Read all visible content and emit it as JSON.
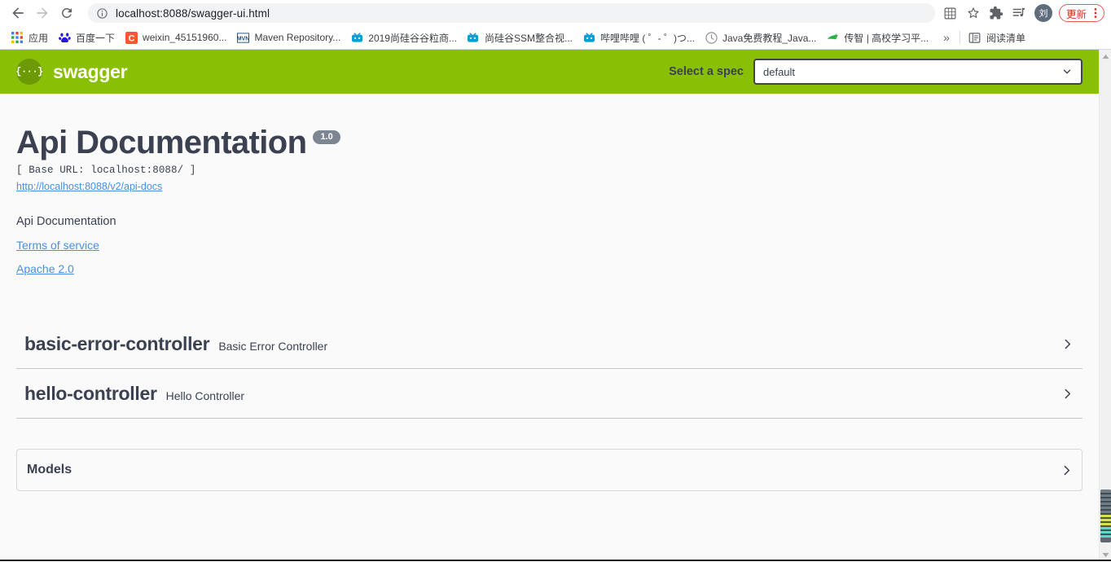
{
  "browser": {
    "nav": {
      "back_icon": "arrow-left-icon",
      "forward_icon": "arrow-right-icon",
      "reload_icon": "reload-icon"
    },
    "omnibox": {
      "info_icon": "info-circle-icon",
      "url": "localhost:8088/swagger-ui.html",
      "url_host": "localhost:8088",
      "url_path": "/swagger-ui.html"
    },
    "toolbar_right": {
      "grid_icon": "grid-panel-icon",
      "bookmark_icon": "star-icon",
      "extensions_icon": "puzzle-piece-icon",
      "reading_list_icon": "playlist-icon",
      "avatar_label": "刘",
      "update_label": "更新",
      "menu_icon": "kebab-menu-icon"
    },
    "bookmarks": [
      {
        "label": "应用",
        "icon": "apps-grid-icon"
      },
      {
        "label": "百度一下",
        "icon": "baidu-icon"
      },
      {
        "label": "weixin_45151960...",
        "icon": "csdn-icon"
      },
      {
        "label": "Maven Repository...",
        "icon": "maven-icon"
      },
      {
        "label": "2019尚硅谷谷粒商...",
        "icon": "bilibili-icon"
      },
      {
        "label": "尚硅谷SSM整合视...",
        "icon": "bilibili-icon"
      },
      {
        "label": "哔哩哔哩 ( ゜- ゜)つ...",
        "icon": "bilibili-icon"
      },
      {
        "label": "Java免费教程_Java...",
        "icon": "clock-icon"
      },
      {
        "label": "传智 | 高校学习平...",
        "icon": "itcast-icon"
      }
    ],
    "bookmarks_overflow": "»",
    "reading_list": {
      "label": "阅读清单",
      "icon": "reading-list-icon"
    }
  },
  "swagger": {
    "topbar": {
      "logo_mark": "{···}",
      "wordmark": "swagger",
      "spec_label": "Select a spec",
      "spec_selected": "default",
      "spec_options": [
        "default"
      ],
      "chevron_icon": "chevron-down-icon"
    },
    "info": {
      "title": "Api Documentation",
      "version": "1.0",
      "base_url": "[ Base URL: localhost:8088/ ]",
      "api_docs_link": "http://localhost:8088/v2/api-docs",
      "description": "Api Documentation",
      "terms_link": "Terms of service",
      "license_link": "Apache 2.0"
    },
    "tags": [
      {
        "name": "basic-error-controller",
        "description": "Basic Error Controller",
        "expand_icon": "chevron-right-icon"
      },
      {
        "name": "hello-controller",
        "description": "Hello Controller",
        "expand_icon": "chevron-right-icon"
      }
    ],
    "models": {
      "title": "Models",
      "expand_icon": "chevron-right-icon"
    }
  },
  "scrollbar": {
    "up_icon": "scroll-up-arrow-icon",
    "down_icon": "scroll-down-arrow-icon"
  },
  "colors": {
    "swagger_green": "#89bf04",
    "swagger_logo_circle": "#6c9a04",
    "text_dark": "#3b4151",
    "link_blue": "#4990e2",
    "version_badge": "#7d8492",
    "update_red": "#d93025"
  }
}
